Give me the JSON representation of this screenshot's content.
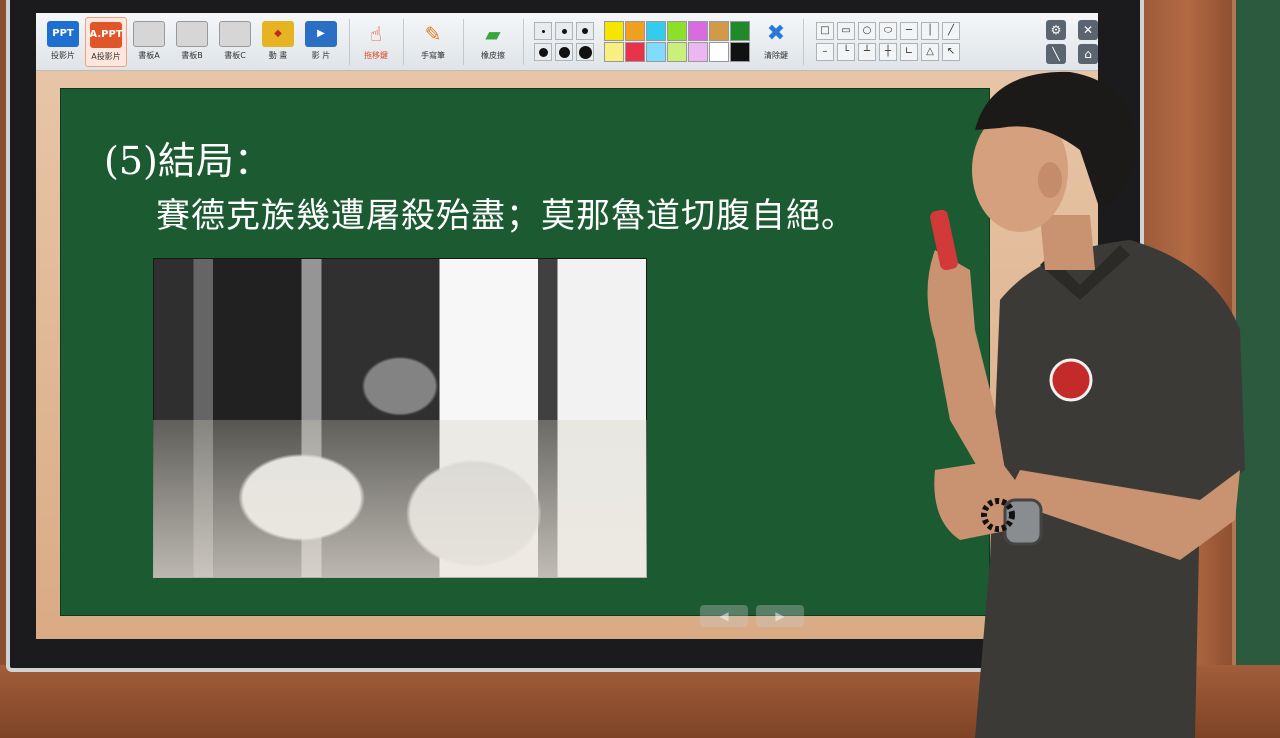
{
  "toolbar": {
    "tools": [
      {
        "icon_text": "PPT",
        "label": "投影片",
        "color": "#1f6fd1"
      },
      {
        "icon_text": "A.PPT",
        "label": "A投影片",
        "color": "#e0562a",
        "active": true
      },
      {
        "icon_text": "",
        "label": "書板A",
        "color": "#c9c9c9"
      },
      {
        "icon_text": "",
        "label": "書板B",
        "color": "#c9c9c9"
      },
      {
        "icon_text": "",
        "label": "書板C",
        "color": "#c9c9c9"
      },
      {
        "icon_text": "",
        "label": "動 畫",
        "color": "#e6b422"
      },
      {
        "icon_text": "▶",
        "label": "影 片",
        "color": "#2a6fc4"
      }
    ],
    "pointer_label": "拖移鍵",
    "pen_label": "手寫筆",
    "eraser_label": "橡皮擦",
    "clear_label": "清除鍵"
  },
  "colors": {
    "palette": [
      "#f5e600",
      "#f0a020",
      "#33ccee",
      "#8ce02a",
      "#d86be0",
      "#d09a4a",
      "#1f8a2a",
      "#f7ef80",
      "#e8334a",
      "#7fdcff",
      "#c8f07a",
      "#ecb6f0",
      "#ffffff",
      "#111111"
    ],
    "board_green": "#1c5a32"
  },
  "slide": {
    "title": "(5)結局：",
    "line1": "賽德克族幾遭屠殺殆盡；莫那魯道切腹自絕。"
  }
}
